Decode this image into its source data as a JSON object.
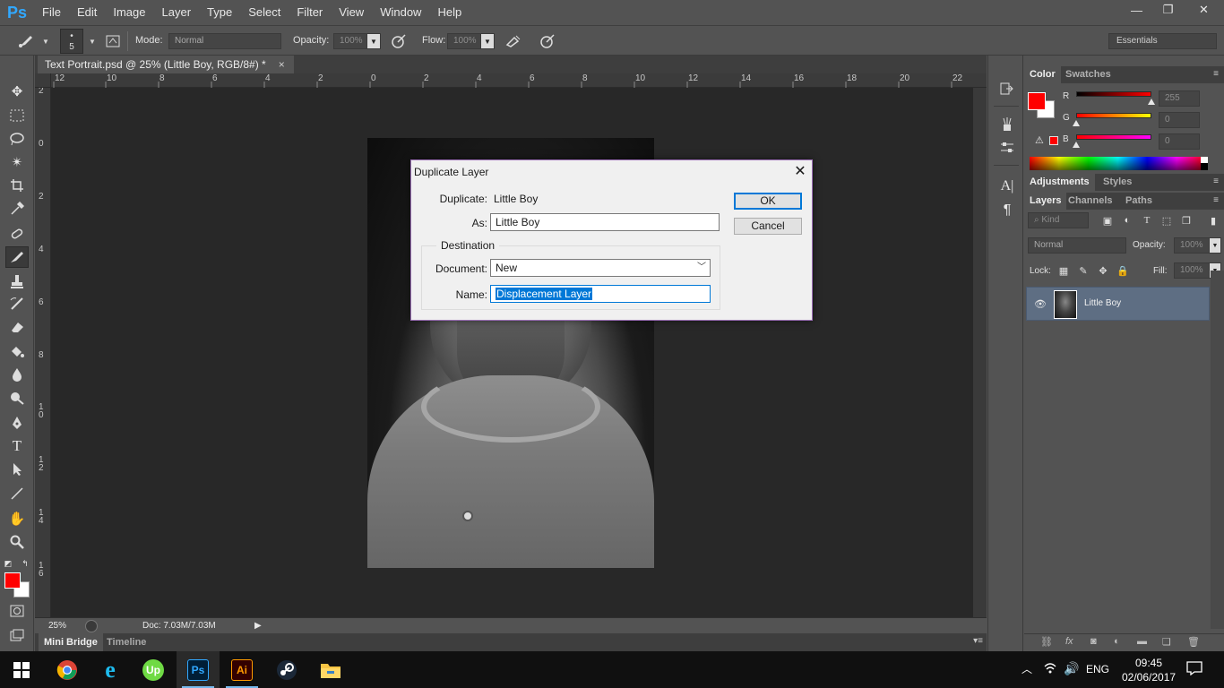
{
  "app": {
    "logo": "Ps",
    "menu": [
      "File",
      "Edit",
      "Image",
      "Layer",
      "Type",
      "Select",
      "Filter",
      "View",
      "Window",
      "Help"
    ],
    "window_controls": {
      "minimize": "—",
      "restore": "❐",
      "close": "✕"
    }
  },
  "options_bar": {
    "brush_size": "5",
    "mode_label": "Mode:",
    "mode_value": "Normal",
    "opacity_label": "Opacity:",
    "opacity_value": "100%",
    "flow_label": "Flow:",
    "flow_value": "100%",
    "workspace": "Essentials"
  },
  "document": {
    "tab_title": "Text Portrait.psd @ 25% (Little Boy, RGB/8#) *",
    "tab_close": "×",
    "zoom": "25%",
    "doc_info": "Doc: 7.03M/7.03M"
  },
  "rulers": {
    "horizontal": [
      "12",
      "10",
      "8",
      "6",
      "4",
      "2",
      "0",
      "2",
      "4",
      "6",
      "8",
      "10",
      "12",
      "14",
      "16",
      "18",
      "20",
      "22"
    ],
    "vertical": [
      "2",
      "0",
      "2",
      "4",
      "6",
      "8",
      "10",
      "12",
      "14",
      "16"
    ]
  },
  "bottom_tabs": {
    "mini_bridge": "Mini Bridge",
    "timeline": "Timeline"
  },
  "color_panel": {
    "tabs": [
      "Color",
      "Swatches"
    ],
    "r_label": "R",
    "r_value": "255",
    "g_label": "G",
    "g_value": "0",
    "b_label": "B",
    "b_value": "0",
    "foreground_color": "#ff0000"
  },
  "adjustments_tabs": [
    "Adjustments",
    "Styles"
  ],
  "layers_panel": {
    "tabs": [
      "Layers",
      "Channels",
      "Paths"
    ],
    "kind_label": "Kind",
    "blend_mode": "Normal",
    "opacity_label": "Opacity:",
    "opacity_value": "100%",
    "lock_label": "Lock:",
    "fill_label": "Fill:",
    "fill_value": "100%",
    "layers": [
      {
        "name": "Little Boy",
        "visible": true,
        "selected": true
      }
    ],
    "footer_fx": "fx"
  },
  "dialog": {
    "title": "Duplicate Layer",
    "duplicate_label": "Duplicate:",
    "duplicate_value": "Little Boy",
    "as_label": "As:",
    "as_value": "Little Boy",
    "destination_label": "Destination",
    "document_label": "Document:",
    "document_value": "New",
    "name_label": "Name:",
    "name_value": "Displacement Layer",
    "ok_label": "OK",
    "cancel_label": "Cancel"
  },
  "taskbar": {
    "apps": [
      {
        "name": "Chrome",
        "running": false
      },
      {
        "name": "Internet Explorer",
        "running": false
      },
      {
        "name": "Upwork",
        "running": false
      },
      {
        "name": "Photoshop",
        "running": true,
        "active": true
      },
      {
        "name": "Illustrator",
        "running": true
      },
      {
        "name": "Steam",
        "running": false
      },
      {
        "name": "File Explorer",
        "running": false
      }
    ],
    "ps_badge": "Ps",
    "ai_badge": "Ai",
    "up_badge": "Up",
    "language": "ENG",
    "time": "09:45",
    "date": "02/06/2017"
  }
}
